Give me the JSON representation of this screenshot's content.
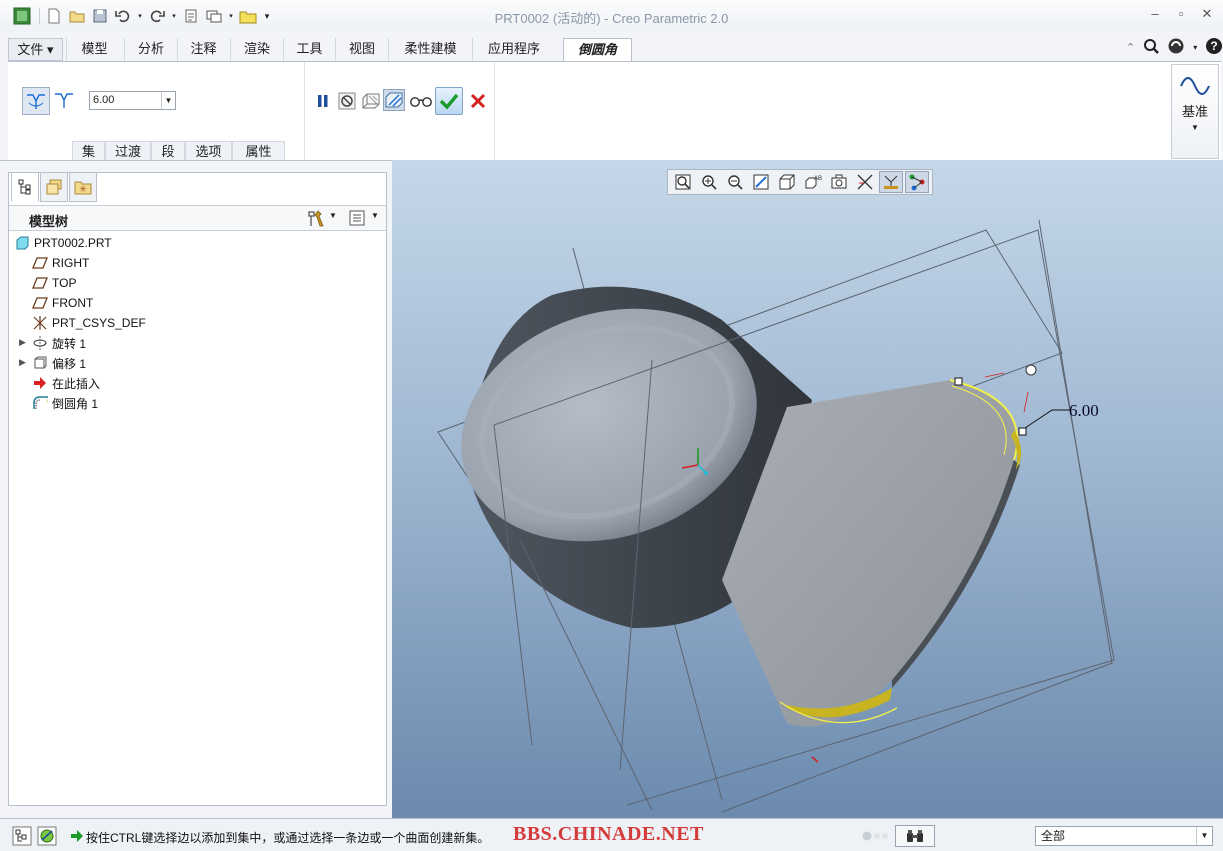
{
  "window": {
    "title": "PRT0002 (活动的) - Creo Parametric 2.0"
  },
  "ribbon": {
    "tabs": [
      {
        "label": "文件"
      },
      {
        "label": "模型"
      },
      {
        "label": "分析"
      },
      {
        "label": "注释"
      },
      {
        "label": "渲染"
      },
      {
        "label": "工具"
      },
      {
        "label": "视图"
      },
      {
        "label": "柔性建模"
      },
      {
        "label": "应用程序"
      },
      {
        "label": "倒圆角"
      }
    ],
    "active_tab": "倒圆角",
    "round": {
      "radius_value": "6.00",
      "panels": [
        "集",
        "过渡",
        "段",
        "选项",
        "属性"
      ]
    },
    "datum_label": "基准"
  },
  "model_tree": {
    "title": "模型树",
    "items": [
      {
        "label": "PRT0002.PRT",
        "icon": "part-icon"
      },
      {
        "label": "RIGHT",
        "icon": "datum-plane-icon"
      },
      {
        "label": "TOP",
        "icon": "datum-plane-icon"
      },
      {
        "label": "FRONT",
        "icon": "datum-plane-icon"
      },
      {
        "label": "PRT_CSYS_DEF",
        "icon": "csys-icon"
      },
      {
        "label": "旋转 1",
        "icon": "revolve-icon"
      },
      {
        "label": "偏移 1",
        "icon": "offset-icon"
      },
      {
        "label": "在此插入",
        "icon": "insert-here-arrow-icon"
      },
      {
        "label": "倒圆角 1",
        "icon": "round-icon"
      }
    ]
  },
  "viewport": {
    "dimension_label": "6.00"
  },
  "status": {
    "message": "按住CTRL键选择边以添加到集中，或通过选择一条边或一个曲面创建新集。",
    "watermark": "BBS.CHINADE.NET",
    "filter_value": "全部"
  },
  "colors": {
    "accent_blue": "#1f6fd6",
    "confirm_green": "#1a9b2a",
    "cancel_red": "#d42020",
    "highlight_yellow": "#f4f04a"
  }
}
